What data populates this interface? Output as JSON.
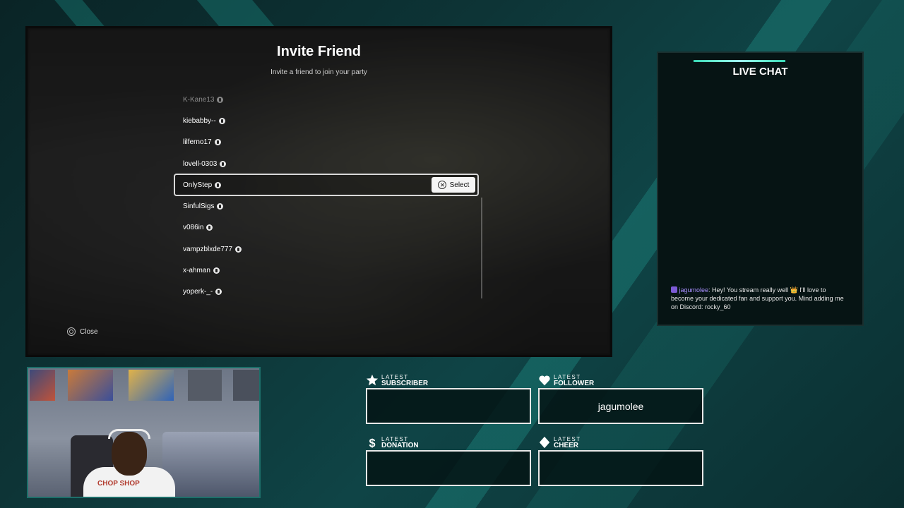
{
  "invite": {
    "title": "Invite Friend",
    "subtitle": "Invite a friend to join your party",
    "friends": [
      {
        "name": "K-Kane13"
      },
      {
        "name": "kiebabby--"
      },
      {
        "name": "lilferno17"
      },
      {
        "name": "lovell-0303"
      },
      {
        "name": "OnlyStep"
      },
      {
        "name": "SinfulSigs"
      },
      {
        "name": "v086in"
      },
      {
        "name": "vampzblxde777"
      },
      {
        "name": "x-ahman"
      },
      {
        "name": "yoperk-_-"
      }
    ],
    "select_label": "Select",
    "close_label": "Close"
  },
  "chat": {
    "title": "LIVE CHAT",
    "message_user": "jagumolee",
    "message_text": ": Hey! You stream really well 👑 I'll love to become your dedicated fan and support you. Mind adding me on Discord: rocky_60"
  },
  "stats": {
    "subscriber": {
      "small": "LATEST",
      "big": "SUBSCRIBER",
      "value": ""
    },
    "follower": {
      "small": "LATEST",
      "big": "FOLLOWER",
      "value": "jagumolee"
    },
    "donation": {
      "small": "LATEST",
      "big": "DONATION",
      "value": ""
    },
    "cheer": {
      "small": "LATEST",
      "big": "CHEER",
      "value": ""
    }
  },
  "webcam": {
    "shirt_text": "CHOP SHOP"
  },
  "colors": {
    "accent": "#38d6b4",
    "background": "#0b2b2c"
  }
}
